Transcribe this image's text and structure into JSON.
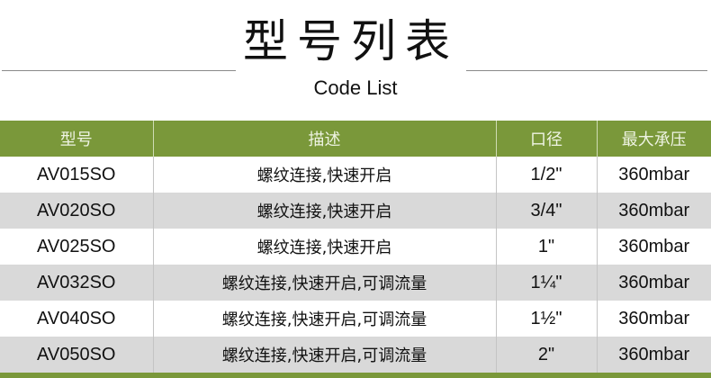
{
  "header": {
    "title": "型号列表",
    "subtitle": "Code List"
  },
  "table": {
    "columns": [
      "型号",
      "描述",
      "口径",
      "最大承压"
    ],
    "rows": [
      {
        "model": "AV015SO",
        "description": "螺纹连接,快速开启",
        "size": "1/2\"",
        "pressure": "360mbar"
      },
      {
        "model": "AV020SO",
        "description": "螺纹连接,快速开启",
        "size": "3/4\"",
        "pressure": "360mbar"
      },
      {
        "model": "AV025SO",
        "description": "螺纹连接,快速开启",
        "size": "1\"",
        "pressure": "360mbar"
      },
      {
        "model": "AV032SO",
        "description": "螺纹连接,快速开启,可调流量",
        "size": "1¼\"",
        "pressure": "360mbar"
      },
      {
        "model": "AV040SO",
        "description": "螺纹连接,快速开启,可调流量",
        "size": "1½\"",
        "pressure": "360mbar"
      },
      {
        "model": "AV050SO",
        "description": "螺纹连接,快速开启,可调流量",
        "size": "2\"",
        "pressure": "360mbar"
      }
    ]
  },
  "colors": {
    "header_green": "#7a983a",
    "row_alt": "#d9d9d9"
  }
}
